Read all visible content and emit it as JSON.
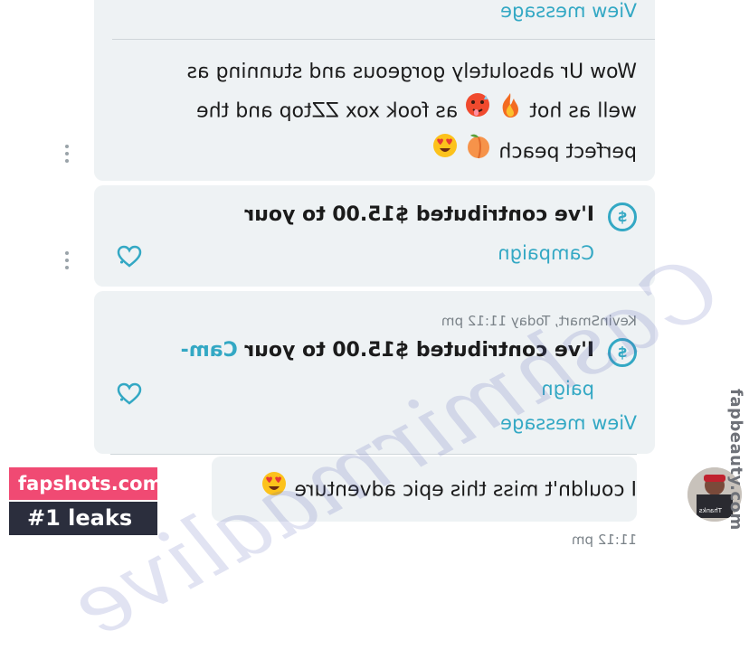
{
  "thread": {
    "top_view_message": "View message",
    "message_1_lines": [
      "Wow Ur absolutely gorgeous and stunning as",
      "well as hot",
      "as fook xox ZZtop and the",
      "perfect peach"
    ],
    "tip_1": {
      "line1": "I've contributed $15.00 to your",
      "link": "Campaign",
      "icon": "dollar-coin-icon"
    },
    "tip_2": {
      "meta": "KevinSmart, Today 11:12 pm",
      "line1": "I've contributed $15.00 to your",
      "link_part1": "Cam-",
      "link_part2": "paign",
      "view_message": "View message",
      "icon": "dollar-coin-icon"
    },
    "message_2": "I couldn't miss this epic adventure",
    "bottom_meta": "11:12 pm",
    "emojis": [
      "fire-icon",
      "hot-face-icon",
      "peach-icon",
      "heart-eyes-icon"
    ],
    "avatar_caption": "Thanks"
  },
  "watermark": {
    "script_text": "Cashmirmaalive",
    "side_text": "fapbeauty.com"
  },
  "badge": {
    "site": "fapshots.com",
    "tagline": "#1 leaks"
  },
  "colors": {
    "accent": "#33a8c4",
    "bubble": "#eef2f4",
    "badge_pink": "#f04a73",
    "badge_dark": "#2b2e3d"
  }
}
